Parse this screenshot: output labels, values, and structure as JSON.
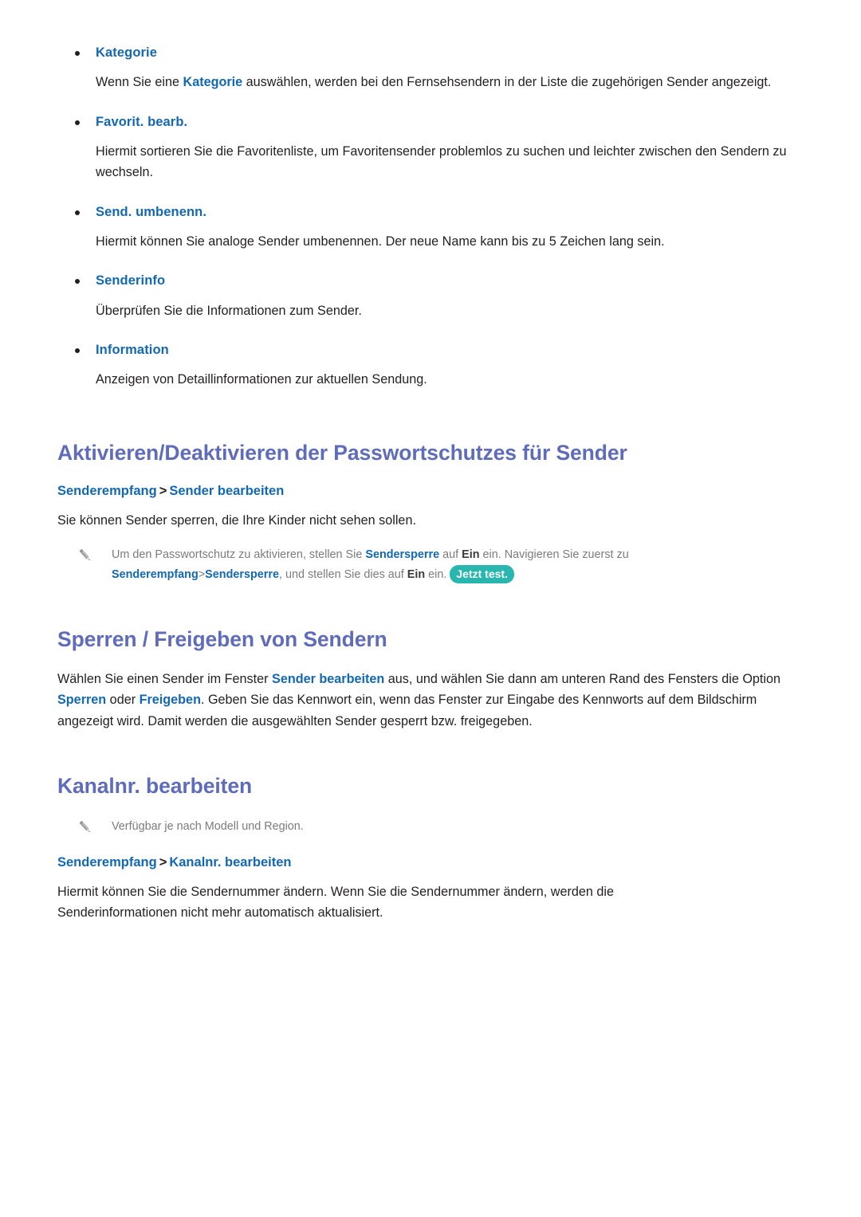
{
  "page": {
    "language": "de",
    "colors": {
      "heading_purple": "#5f6cba",
      "link_blue": "#1268b3",
      "body_text": "#231f20",
      "note_gray": "#7c7c7c",
      "try_now_teal": "#28b6ae",
      "background": "#ffffff"
    }
  },
  "options": [
    {
      "label": "Kategorie",
      "description_pre": "Wenn Sie eine ",
      "description_link": "Kategorie",
      "description_post": " auswählen, werden bei den Fernsehsendern in der Liste die zugehörigen Sender angezeigt."
    },
    {
      "label": "Favorit. bearb.",
      "description": "Hiermit sortieren Sie die Favoritenliste, um Favoritensender problemlos zu suchen und leichter zwischen den Sendern zu wechseln."
    },
    {
      "label": "Send. umbenenn.",
      "description": "Hiermit können Sie analoge Sender umbenennen. Der neue Name kann bis zu 5 Zeichen lang sein."
    },
    {
      "label": "Senderinfo",
      "description": "Überprüfen Sie die Informationen zum Sender."
    },
    {
      "label": "Information",
      "description": "Anzeigen von Detaillinformationen zur aktuellen Sendung."
    }
  ],
  "section_password": {
    "title": "Aktivieren/Deaktivieren der Passwortschutzes für Sender",
    "breadcrumb": {
      "first": "Senderempfang",
      "separator": ">",
      "second": "Sender bearbeiten"
    },
    "paragraph": "Sie können Sender sperren, die Ihre Kinder nicht sehen sollen.",
    "note": {
      "t1": "Um den Passwortschutz zu aktivieren, stellen Sie ",
      "b1": "Sendersperre",
      "t2": " auf ",
      "b2": "Ein",
      "t3": " ein. Navigieren Sie zuerst zu ",
      "b3": "Senderempfang",
      "sep": ">",
      "b4": "Sendersperre",
      "t4": ", und stellen Sie dies auf ",
      "b5": "Ein",
      "t5": " ein. ",
      "try_now": "Jetzt test."
    }
  },
  "section_lock": {
    "title": "Sperren / Freigeben von Sendern",
    "paragraph": {
      "t1": "Wählen Sie einen Sender im Fenster ",
      "b1": "Sender bearbeiten",
      "t2": " aus, und wählen Sie dann am unteren Rand des Fensters die Option ",
      "b2": "Sperren",
      "t3": " oder ",
      "b3": "Freigeben",
      "t4": ". Geben Sie das Kennwort ein, wenn das Fenster zur Eingabe des Kennworts auf dem Bildschirm angezeigt wird. Damit werden die ausgewählten Sender gesperrt bzw. freigegeben."
    }
  },
  "section_channel_number": {
    "title": "Kanalnr. bearbeiten",
    "note": "Verfügbar je nach Modell und Region.",
    "breadcrumb": {
      "first": "Senderempfang",
      "separator": ">",
      "second": "Kanalnr. bearbeiten"
    },
    "paragraph": "Hiermit können Sie die Sendernummer ändern. Wenn Sie die Sendernummer ändern, werden die Senderinformationen nicht mehr automatisch aktualisiert."
  },
  "icons": {
    "pencil": "pencil-icon",
    "bullet": "bullet-dot"
  }
}
